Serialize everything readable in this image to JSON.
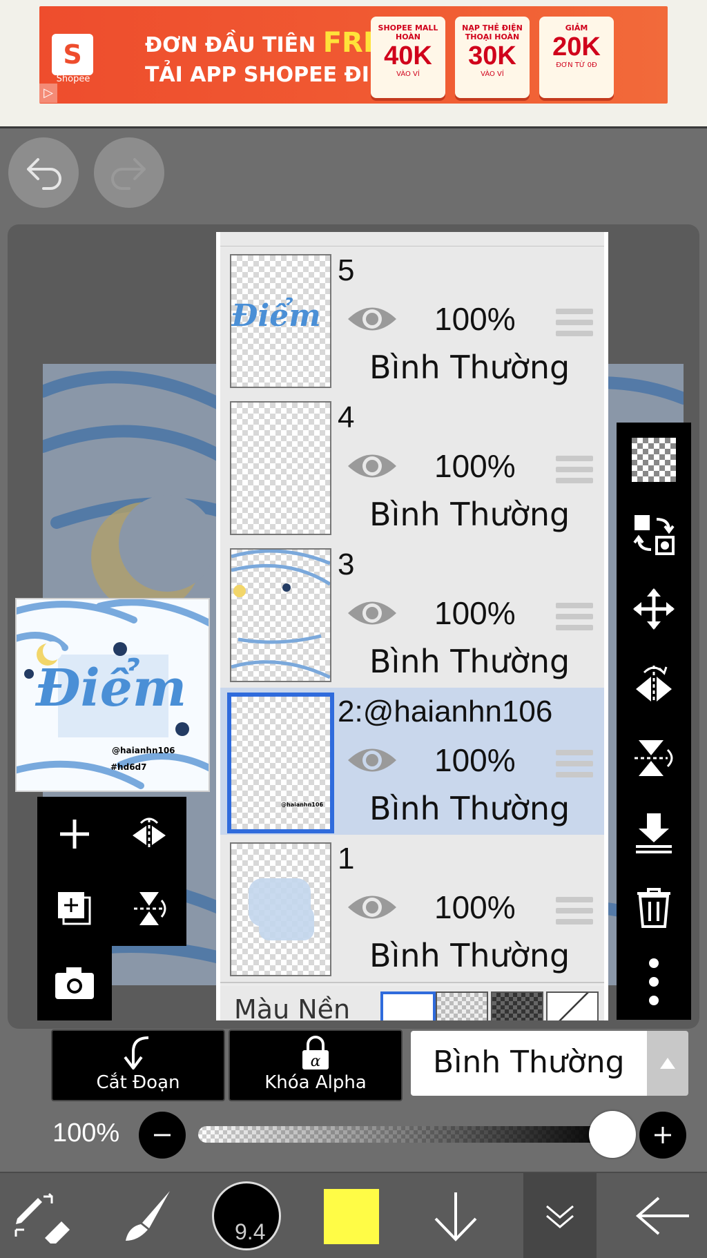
{
  "ad": {
    "logo_char": "S",
    "logo_caption": "Shopee",
    "line1_prefix": "ĐƠN ĐẦU TIÊN ",
    "line1_highlight": "FREE",
    "line2": "TẢI APP SHOPEE ĐI",
    "coupons": [
      {
        "top": "SHOPEE MALL HOÀN",
        "value": "40K",
        "sub": "VÀO VÍ"
      },
      {
        "top": "NẠP THẺ ĐIỆN THOẠI HOÀN",
        "value": "30K",
        "sub": "VÀO VÍ"
      },
      {
        "top": "GIẢM",
        "value": "20K",
        "sub": "ĐƠN TỪ 0Đ"
      }
    ]
  },
  "canvas": {
    "thumbnail_word": "Điểm",
    "thumbnail_handle": "@haianhn106",
    "thumbnail_code": "#hd6d7"
  },
  "layers": [
    {
      "name": "5",
      "opacity": "100%",
      "mode": "Bình Thường",
      "selected": false
    },
    {
      "name": "4",
      "opacity": "100%",
      "mode": "Bình Thường",
      "selected": false
    },
    {
      "name": "3",
      "opacity": "100%",
      "mode": "Bình Thường",
      "selected": false
    },
    {
      "name": "2:@haianhn106",
      "opacity": "100%",
      "mode": "Bình Thường",
      "selected": true
    },
    {
      "name": "1",
      "opacity": "100%",
      "mode": "Bình Thường",
      "selected": false
    }
  ],
  "background_row": {
    "label": "Màu Nền"
  },
  "controls": {
    "clip_label": "Cắt Đoạn",
    "alpha_label": "Khóa Alpha",
    "blend_mode": "Bình Thường",
    "opacity_label": "100%",
    "opacity_value": 1.0
  },
  "bottom_nav": {
    "brush_size": "9.4",
    "current_color": "#fffc46"
  },
  "colors": {
    "accent_selected_layer": "#c9d7ec",
    "selected_border": "#2f6bdc",
    "ad_orange": "#ee4d2d"
  }
}
